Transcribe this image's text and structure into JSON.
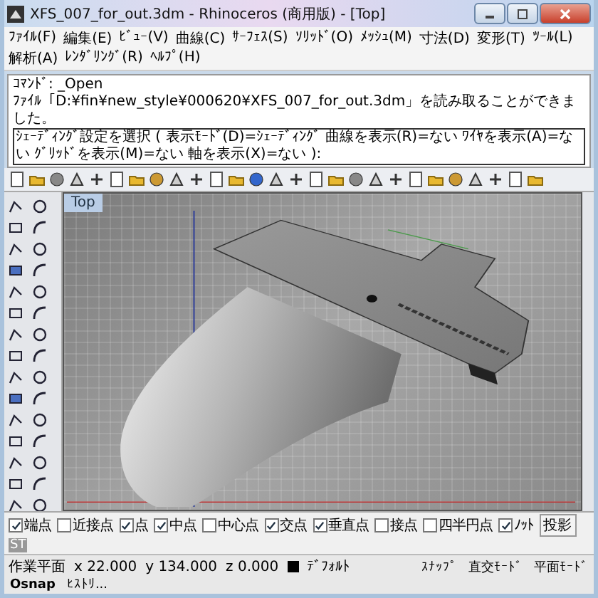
{
  "window": {
    "title": "XFS_007_for_out.3dm - Rhinoceros (商用版) - [Top]"
  },
  "menu": [
    "ﾌｧｲﾙ(F)",
    "編集(E)",
    "ﾋﾞｭｰ(V)",
    "曲線(C)",
    "ｻｰﾌｪｽ(S)",
    "ｿﾘｯﾄﾞ(O)",
    "ﾒｯｼｭ(M)",
    "寸法(D)",
    "変形(T)",
    "ﾂｰﾙ(L)",
    "解析(A)",
    "ﾚﾝﾀﾞﾘﾝｸﾞ(R)",
    "ﾍﾙﾌﾟ(H)"
  ],
  "command_history": [
    "ｺﾏﾝﾄﾞ: _Open",
    "ﾌｧｲﾙ「D:¥fin¥new_style¥000620¥XFS_007_for_out.3dm」を読み取ることができました。"
  ],
  "command_prompt": "ｼｪｰﾃﾞｨﾝｸﾞ設定を選択 ( 表示ﾓｰﾄﾞ(D)=ｼｪｰﾃﾞｨﾝｸﾞ 曲線を表示(R)=ない ﾜｲﾔを表示(A)=ない ｸﾞﾘｯﾄﾞを表示(M)=ない 軸を表示(X)=ない ):",
  "viewport": {
    "title": "Top"
  },
  "osnap": [
    {
      "kind": "checkbox",
      "label": "端点",
      "checked": true
    },
    {
      "kind": "checkbox",
      "label": "近接点",
      "checked": false
    },
    {
      "kind": "checkbox",
      "label": "点",
      "checked": true
    },
    {
      "kind": "checkbox",
      "label": "中点",
      "checked": true
    },
    {
      "kind": "checkbox",
      "label": "中心点",
      "checked": false
    },
    {
      "kind": "checkbox",
      "label": "交点",
      "checked": true
    },
    {
      "kind": "checkbox",
      "label": "垂直点",
      "checked": true
    },
    {
      "kind": "checkbox",
      "label": "接点",
      "checked": false
    },
    {
      "kind": "checkbox",
      "label": "四半円点",
      "checked": false
    },
    {
      "kind": "checkbox",
      "label": "ﾉｯﾄ",
      "checked": true
    },
    {
      "kind": "toggle",
      "label": "投影",
      "checked": false
    },
    {
      "kind": "tab",
      "label": "ST"
    }
  ],
  "status_bar": {
    "plane": "作業平面",
    "x": "x 22.000",
    "y": "y 134.000",
    "z": "z 0.000",
    "layer": "ﾃﾞﾌｫﾙﾄ",
    "toggles": [
      {
        "label": "ｽﾅｯﾌﾟ",
        "on": false
      },
      {
        "label": "直交ﾓｰﾄﾞ",
        "on": false
      },
      {
        "label": "平面ﾓｰﾄﾞ",
        "on": false
      },
      {
        "label": "Osnap",
        "on": true
      },
      {
        "label": "ﾋｽﾄﾘ...",
        "on": false
      }
    ]
  }
}
